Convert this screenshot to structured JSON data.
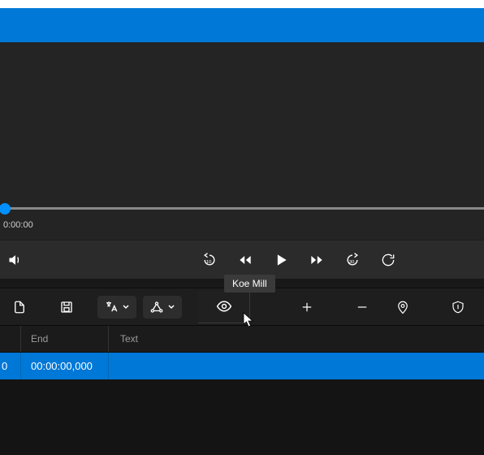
{
  "player": {
    "currentTime": "0:00:00"
  },
  "tooltip": "Koe Mill",
  "table": {
    "headers": {
      "end": "End",
      "text": "Text"
    },
    "row": {
      "start_trunc": "0",
      "end": "00:00:00,000",
      "text": ""
    }
  }
}
